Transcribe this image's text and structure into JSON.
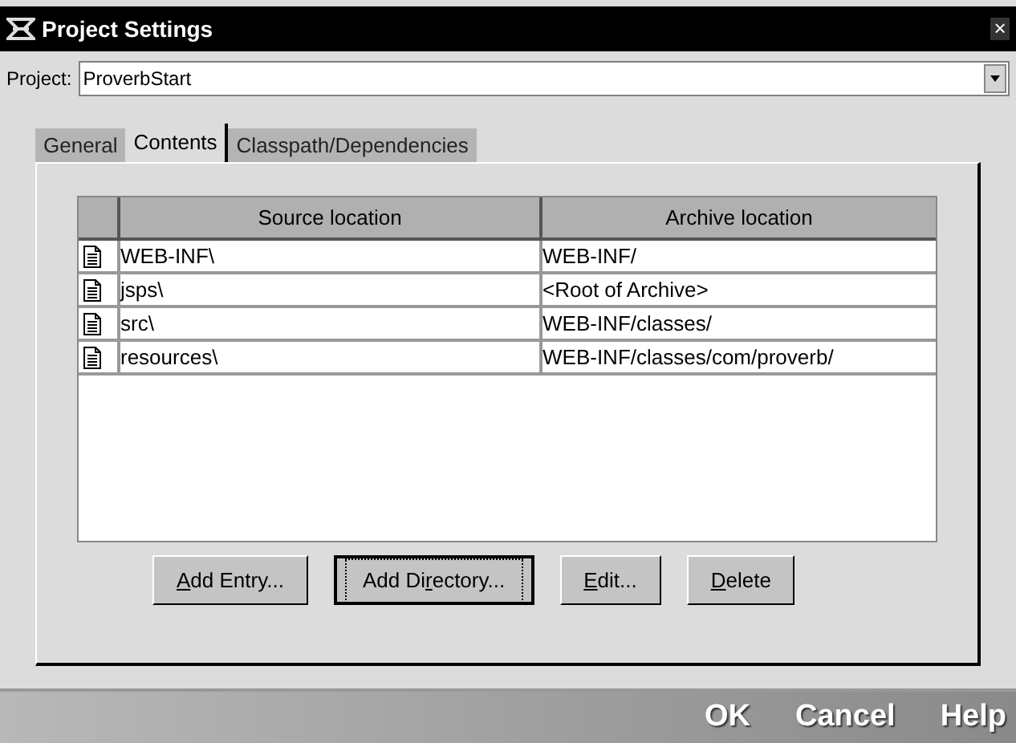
{
  "window": {
    "title": "Project Settings",
    "close": "×"
  },
  "project": {
    "label": "Project:",
    "value": "ProverbStart"
  },
  "tabs": [
    {
      "label": "General",
      "selected": false
    },
    {
      "label": "Contents",
      "selected": true
    },
    {
      "label": "Classpath/Dependencies",
      "selected": false
    }
  ],
  "table": {
    "columns": [
      "Source location",
      "Archive location"
    ],
    "rows": [
      {
        "source": "WEB-INF\\",
        "archive": "WEB-INF/"
      },
      {
        "source": "jsps\\",
        "archive": "<Root of Archive>"
      },
      {
        "source": "src\\",
        "archive": "WEB-INF/classes/"
      },
      {
        "source": "resources\\",
        "archive": "WEB-INF/classes/com/proverb/"
      }
    ]
  },
  "buttons": [
    {
      "underlined_key": "A",
      "label_after": "dd Entry...",
      "focused": false
    },
    {
      "label_before": "Add Di",
      "underlined_key": "r",
      "label_after": "ectory...",
      "focused": true
    },
    {
      "underlined_key": "E",
      "label_after": "dit...",
      "focused": false
    },
    {
      "underlined_key": "D",
      "label_after": "elete",
      "focused": false
    }
  ],
  "footer_buttons": [
    "OK",
    "Cancel",
    "Help"
  ]
}
